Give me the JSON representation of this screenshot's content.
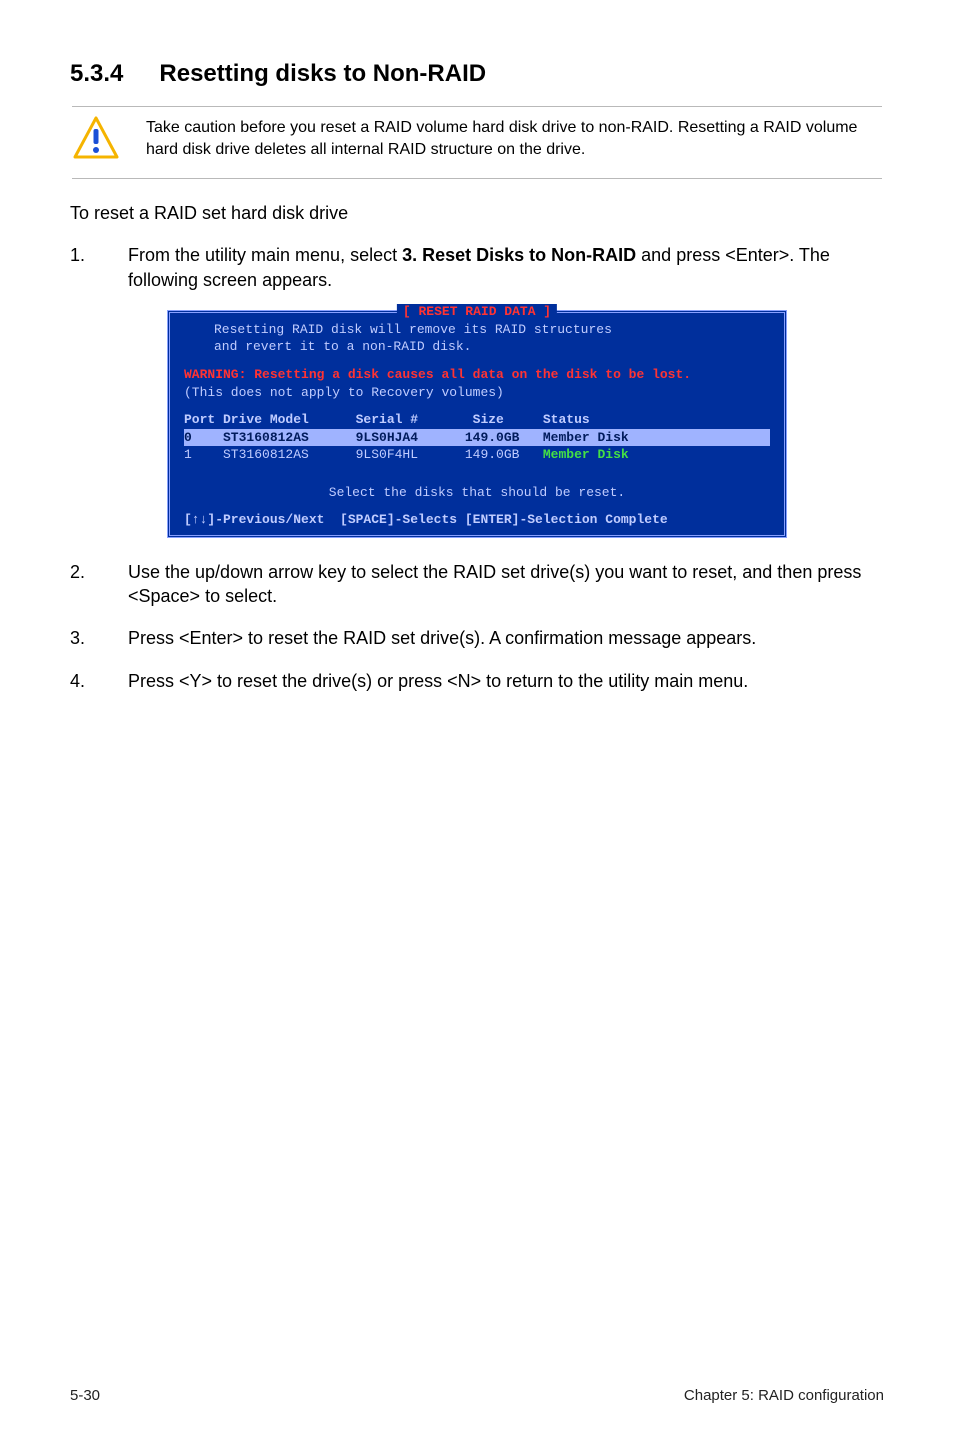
{
  "heading": {
    "num": "5.3.4",
    "title": "Resetting disks to Non-RAID"
  },
  "caution": "Take caution before you reset a RAID volume hard disk drive to non-RAID. Resetting a RAID volume hard disk drive deletes all internal RAID structure on the drive.",
  "lead": "To reset a RAID set hard disk drive",
  "steps": {
    "s1_pre": "From the utility main menu, select ",
    "s1_bold": "3. Reset Disks to Non-RAID",
    "s1_post": " and press <Enter>. The following screen appears.",
    "s2": "Use the up/down arrow key to select the RAID set drive(s) you want to reset, and then press <Space> to select.",
    "s3": "Press <Enter> to reset the RAID set drive(s). A confirmation message appears.",
    "s4": "Press <Y> to reset the drive(s) or press <N> to return to the utility main menu."
  },
  "terminal": {
    "title": "[ RESET RAID DATA ]",
    "msg1": "Resetting RAID disk will remove its RAID structures",
    "msg2": "and revert it to a non-RAID disk.",
    "warn": "WARNING: Resetting a disk causes all data on the disk to be lost.",
    "note": "(This does not apply to Recovery volumes)",
    "hdr": "Port Drive Model      Serial #       Size     Status",
    "row0": "0    ST3160812AS      9LS0HJA4      149.0GB   Member Disk     ",
    "row1_pre": "1    ST3160812AS      9LS0F4HL      149.0GB   ",
    "row1_status": "Member Disk",
    "select_msg": "Select the disks that should be reset.",
    "footer": "[↑↓]-Previous/Next  [SPACE]-Selects [ENTER]-Selection Complete"
  },
  "footer": {
    "left": "5-30",
    "right": "Chapter 5: RAID configuration"
  },
  "chart_data": {
    "type": "table",
    "title": "RESET RAID DATA disk list",
    "columns": [
      "Port",
      "Drive Model",
      "Serial #",
      "Size",
      "Status"
    ],
    "rows": [
      {
        "Port": 0,
        "Drive Model": "ST3160812AS",
        "Serial #": "9LS0HJA4",
        "Size": "149.0GB",
        "Status": "Member Disk",
        "selected": true
      },
      {
        "Port": 1,
        "Drive Model": "ST3160812AS",
        "Serial #": "9LS0F4HL",
        "Size": "149.0GB",
        "Status": "Member Disk",
        "selected": false
      }
    ]
  }
}
